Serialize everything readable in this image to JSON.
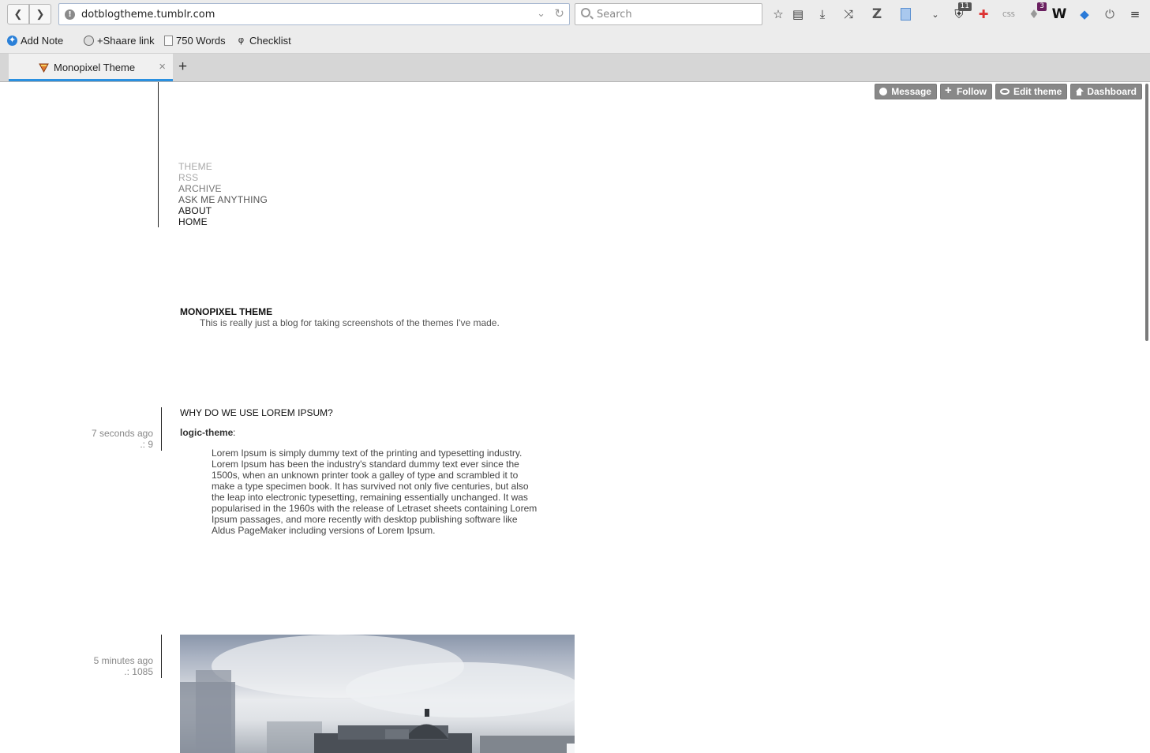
{
  "browser": {
    "url": "dotblogtheme.tumblr.com",
    "search_placeholder": "Search",
    "badges": {
      "ublock": "11",
      "notifications": "3"
    },
    "bookmarks": [
      {
        "label": "Add Note",
        "icon": "add-note-icon"
      },
      {
        "label": "+Shaare link",
        "icon": "globe-icon"
      },
      {
        "label": "750 Words",
        "icon": "page-icon"
      },
      {
        "label": "Checklist",
        "icon": "checklist-icon"
      }
    ],
    "tab": {
      "title": "Monopixel Theme"
    },
    "accent_color": "#2a90e0"
  },
  "tumblr_controls": {
    "message": "Message",
    "follow": "Follow",
    "edit_theme": "Edit theme",
    "dashboard": "Dashboard"
  },
  "nav": {
    "theme": "THEME",
    "rss": "RSS",
    "archive": "ARCHIVE",
    "ask": "ASK ME ANYTHING",
    "about": "ABOUT",
    "home": "HOME"
  },
  "blog": {
    "title": "MONOPIXEL THEME",
    "description": "This is really just a blog for taking screenshots of the themes I've made."
  },
  "posts": [
    {
      "time": "7 seconds ago",
      "notes": ".: 9",
      "title": "WHY DO WE USE LOREM IPSUM?",
      "author": "logic-theme",
      "body": "Lorem Ipsum is simply dummy text of the printing and typesetting industry. Lorem Ipsum has been the industry's standard dummy text ever since the 1500s, when an unknown printer took a galley of type and scrambled it to make a type specimen book. It has survived not only five centuries, but also the leap into electronic typesetting, remaining essentially unchanged. It was popularised in the 1960s with the release of Letraset sheets containing Lorem Ipsum passages, and more recently with desktop publishing software like Aldus PageMaker including versions of Lorem Ipsum."
    },
    {
      "time": "5 minutes ago",
      "notes": ".: 1085"
    }
  ]
}
